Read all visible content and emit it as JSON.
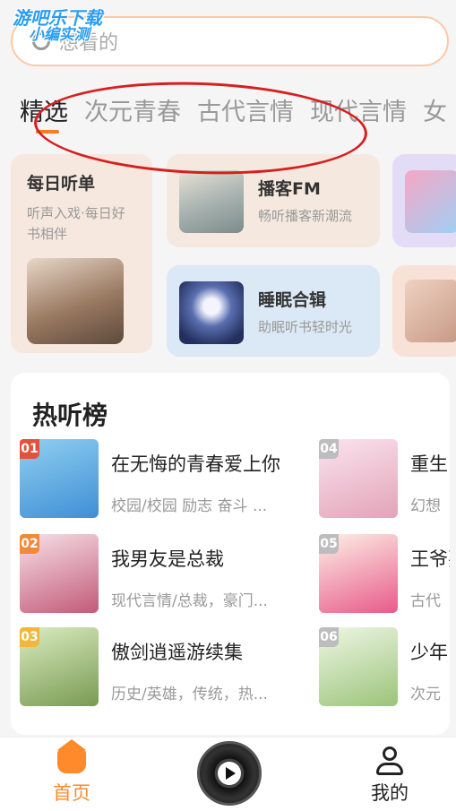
{
  "watermark": {
    "line1": "游吧乐下载",
    "line2": "小编实测"
  },
  "search": {
    "placeholder": "想看的"
  },
  "tabs": [
    "精选",
    "次元青春",
    "古代言情",
    "现代言情",
    "女"
  ],
  "feature_cards": {
    "daily": {
      "title": "每日听单",
      "subtitle": "听声入戏·每日好书相伴"
    },
    "podcast": {
      "title": "播客FM",
      "subtitle": "畅听播客新潮流"
    },
    "sleep": {
      "title": "睡眠合辑",
      "subtitle": "助眠听书轻时光"
    }
  },
  "hot_list": {
    "title": "热听榜",
    "items": [
      {
        "rank": "01",
        "name": "在无悔的青春爱上你",
        "meta": "校园/校园 励志 奋斗 ...",
        "color": "#e0533a"
      },
      {
        "rank": "02",
        "name": "我男友是总裁",
        "meta": "现代言情/总裁，豪门...",
        "color": "#f08a3a"
      },
      {
        "rank": "03",
        "name": "傲剑逍遥游续集",
        "meta": "历史/英雄，传统，热...",
        "color": "#f3b63a"
      },
      {
        "rank": "04",
        "name": "重生",
        "meta": "幻想",
        "color": "#bdbdbd"
      },
      {
        "rank": "05",
        "name": "王爷要下",
        "meta": "古代",
        "color": "#bdbdbd"
      },
      {
        "rank": "06",
        "name": "少年",
        "meta": "次元",
        "color": "#bdbdbd"
      }
    ]
  },
  "bottom_nav": {
    "home": "首页",
    "me": "我的"
  }
}
